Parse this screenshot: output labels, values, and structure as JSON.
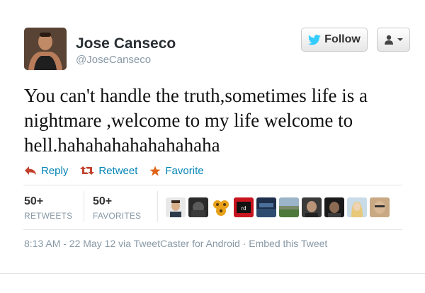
{
  "user": {
    "name": "Jose Canseco",
    "handle": "@JoseCanseco"
  },
  "buttons": {
    "follow_label": "Follow",
    "follow_icon": "twitter-bird-icon",
    "user_menu_icon": "person-icon"
  },
  "tweet": {
    "text": "You can't handle the truth,sometimes life is a nightmare ,welcome to my life welcome to hell.hahahahahahahahaha"
  },
  "actions": {
    "reply": "Reply",
    "retweet": "Retweet",
    "favorite": "Favorite"
  },
  "stats": {
    "retweets_count": "50+",
    "retweets_label": "RETWEETS",
    "favorites_count": "50+",
    "favorites_label": "FAVORITES"
  },
  "meta": {
    "timestamp": "8:13 AM - 22 May 12",
    "via_prefix": "via",
    "client": "TweetCaster for Android",
    "separator": "·",
    "embed": "Embed this Tweet"
  },
  "colors": {
    "link": "#0084b4",
    "favorite_star": "#e0641a",
    "muted": "#8899a6"
  }
}
